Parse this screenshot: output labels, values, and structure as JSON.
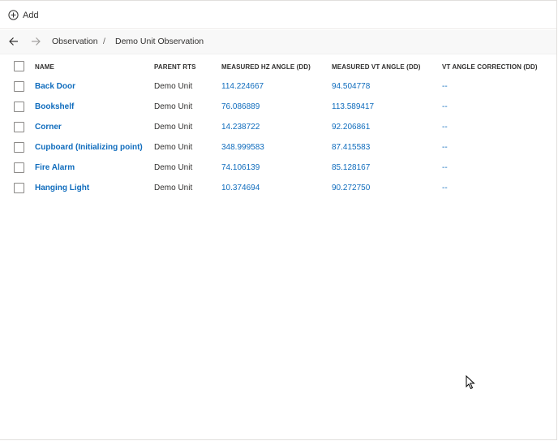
{
  "commandbar": {
    "add_label": "Add"
  },
  "breadcrumb": {
    "items": [
      "Observation",
      "Demo Unit Observation"
    ],
    "separator": "/"
  },
  "grid": {
    "columns": [
      "NAME",
      "PARENT RTS",
      "MEASURED HZ ANGLE (DD)",
      "MEASURED VT ANGLE (DD)",
      "VT ANGLE CORRECTION (DD)"
    ],
    "rows": [
      {
        "name": "Back Door",
        "parent": "Demo Unit",
        "hz": "114.224667",
        "vt": "94.504778",
        "correction": "--"
      },
      {
        "name": "Bookshelf",
        "parent": "Demo Unit",
        "hz": "76.086889",
        "vt": "113.589417",
        "correction": "--"
      },
      {
        "name": "Corner",
        "parent": "Demo Unit",
        "hz": "14.238722",
        "vt": "92.206861",
        "correction": "--"
      },
      {
        "name": "Cupboard (Initializing point)",
        "parent": "Demo Unit",
        "hz": "348.999583",
        "vt": "87.415583",
        "correction": "--"
      },
      {
        "name": "Fire Alarm",
        "parent": "Demo Unit",
        "hz": "74.106139",
        "vt": "85.128167",
        "correction": "--"
      },
      {
        "name": "Hanging Light",
        "parent": "Demo Unit",
        "hz": "10.374694",
        "vt": "90.272750",
        "correction": "--"
      }
    ]
  },
  "colors": {
    "link": "#0f6cbd",
    "text": "#323130",
    "navbar_bg": "#f8f8f8"
  },
  "icons": {
    "add": "add-circle-icon",
    "back": "arrow-left-icon",
    "forward": "arrow-right-icon",
    "cursor": "mouse-pointer-icon"
  }
}
